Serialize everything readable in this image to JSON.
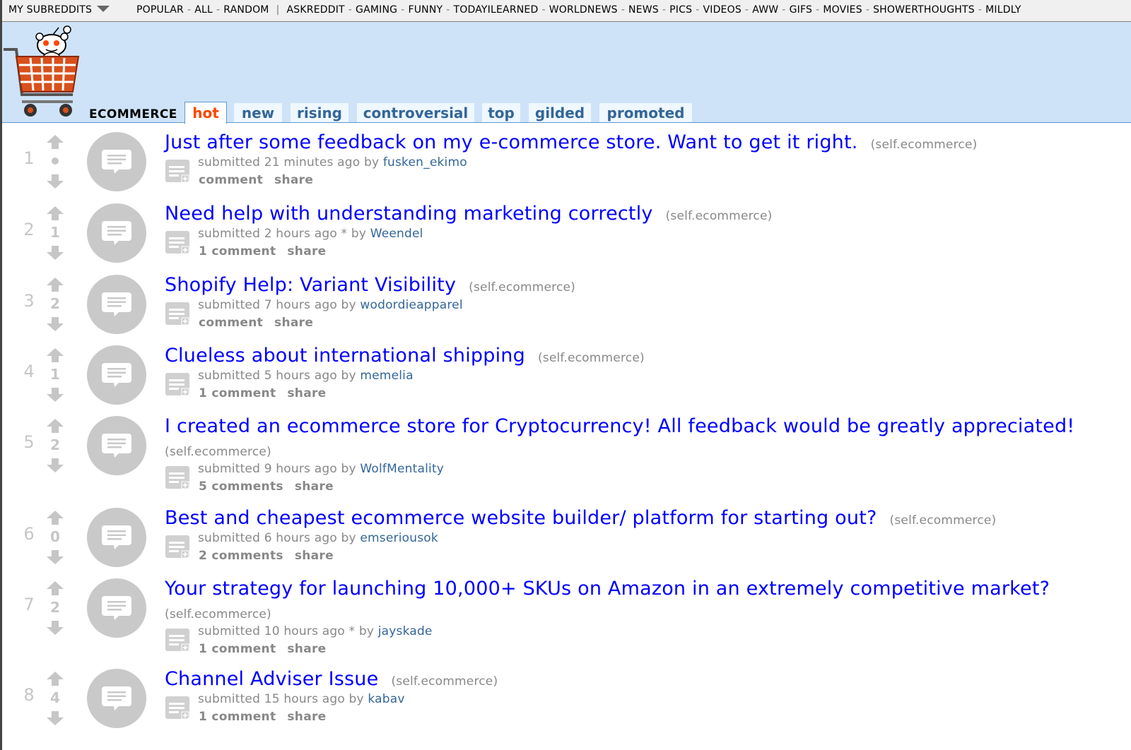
{
  "topbar": {
    "my_subreddits": "MY SUBREDDITS",
    "links": [
      "POPULAR",
      "ALL",
      "RANDOM"
    ],
    "sub_links": [
      "ASKREDDIT",
      "GAMING",
      "FUNNY",
      "TODAYILEARNED",
      "WORLDNEWS",
      "NEWS",
      "PICS",
      "VIDEOS",
      "AWW",
      "GIFS",
      "MOVIES",
      "SHOWERTHOUGHTS",
      "MILDLY"
    ]
  },
  "header": {
    "subreddit": "ECOMMERCE",
    "tabs": [
      "hot",
      "new",
      "rising",
      "controversial",
      "top",
      "gilded",
      "promoted"
    ],
    "selected_tab": "hot"
  },
  "colors": {
    "header_bg": "#cee3f8",
    "link": "#0000ff",
    "selected_tab": "#ff4500",
    "author": "#336699",
    "muted": "#888888"
  },
  "posts": [
    {
      "rank": "1",
      "score": "•",
      "title": "Just after some feedback on my e-commerce store. Want to get it right.",
      "domain": "(self.ecommerce)",
      "submitted": "submitted 21 minutes ago by",
      "author": "fusken_ekimo",
      "comments": "comment",
      "share": "share"
    },
    {
      "rank": "2",
      "score": "1",
      "title": "Need help with understanding marketing correctly",
      "domain": "(self.ecommerce)",
      "submitted": "submitted 2 hours ago * by",
      "author": "Weendel",
      "comments": "1 comment",
      "share": "share"
    },
    {
      "rank": "3",
      "score": "2",
      "title": "Shopify Help: Variant Visibility",
      "domain": "(self.ecommerce)",
      "submitted": "submitted 7 hours ago by",
      "author": "wodordieapparel",
      "comments": "comment",
      "share": "share"
    },
    {
      "rank": "4",
      "score": "1",
      "title": "Clueless about international shipping",
      "domain": "(self.ecommerce)",
      "submitted": "submitted 5 hours ago by",
      "author": "memelia",
      "comments": "1 comment",
      "share": "share"
    },
    {
      "rank": "5",
      "score": "2",
      "title": "I created an ecommerce store for Cryptocurrency! All feedback would be greatly appreciated!",
      "domain": "(self.ecommerce)",
      "submitted": "submitted 9 hours ago by",
      "author": "WolfMentality",
      "comments": "5 comments",
      "share": "share"
    },
    {
      "rank": "6",
      "score": "0",
      "title": "Best and cheapest ecommerce website builder/ platform for starting out?",
      "domain": "(self.ecommerce)",
      "submitted": "submitted 6 hours ago by",
      "author": "emseriousok",
      "comments": "2 comments",
      "share": "share"
    },
    {
      "rank": "7",
      "score": "2",
      "title": "Your strategy for launching 10,000+ SKUs on Amazon in an extremely competitive market?",
      "domain": "(self.ecommerce)",
      "submitted": "submitted 10 hours ago * by",
      "author": "jayskade",
      "comments": "1 comment",
      "share": "share"
    },
    {
      "rank": "8",
      "score": "4",
      "title": "Channel Adviser Issue",
      "domain": "(self.ecommerce)",
      "submitted": "submitted 15 hours ago by",
      "author": "kabav",
      "comments": "1 comment",
      "share": "share"
    }
  ]
}
